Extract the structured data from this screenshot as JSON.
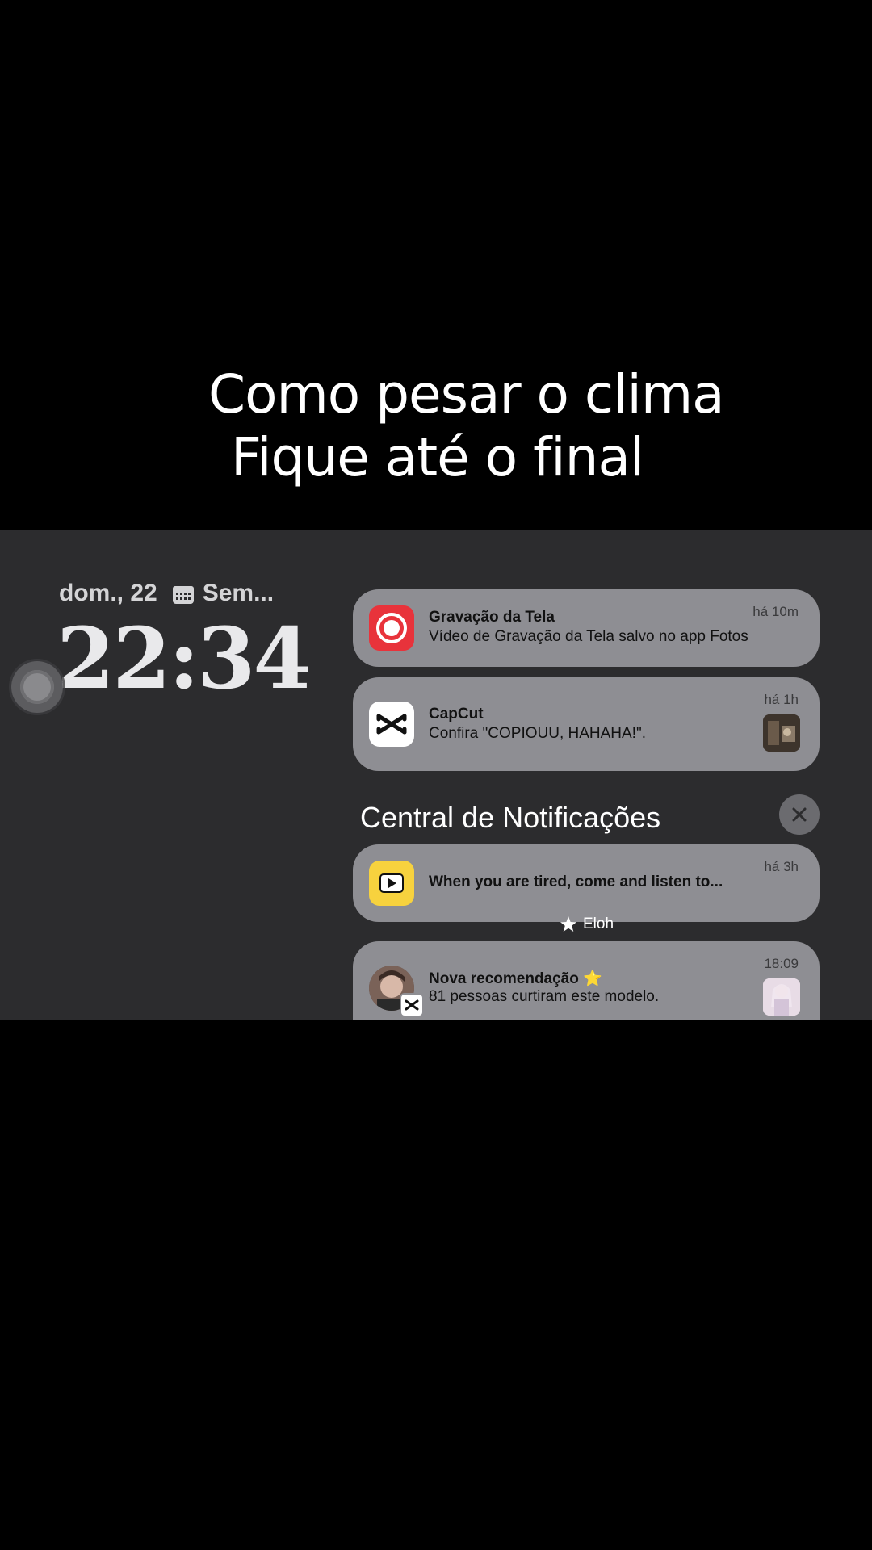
{
  "caption": {
    "line1": "Como pesar o clima",
    "line2": "Fique até o final"
  },
  "lockscreen": {
    "date": "dom., 22",
    "calendar_label": "Sem...",
    "time": "22:34"
  },
  "notifications": [
    {
      "app": "Gravação da Tela",
      "title": "Gravação da Tela",
      "body": "Vídeo de Gravação da Tela salvo no app Fotos",
      "time": "há 10m",
      "icon": "screen-record-icon",
      "icon_color": "#e8333b"
    },
    {
      "app": "CapCut",
      "title": "CapCut",
      "body": "Confira \"COPIOUU, HAHAHA!\".",
      "time": "há 1h",
      "icon": "capcut-icon",
      "icon_color": "#ffffff"
    }
  ],
  "notification_center": {
    "header": "Central de Notificações",
    "close_icon": "close-icon"
  },
  "center_items": [
    {
      "title": "When you are tired, come and listen to...",
      "time": "há 3h",
      "icon": "play-icon",
      "icon_color": "#f7d23e",
      "stack_label": "Eloh"
    },
    {
      "title": "Nova recomendação ⭐",
      "body": "81 pessoas curtiram este modelo.",
      "time": "18:09",
      "icon": "avatar-capcut-icon"
    }
  ]
}
